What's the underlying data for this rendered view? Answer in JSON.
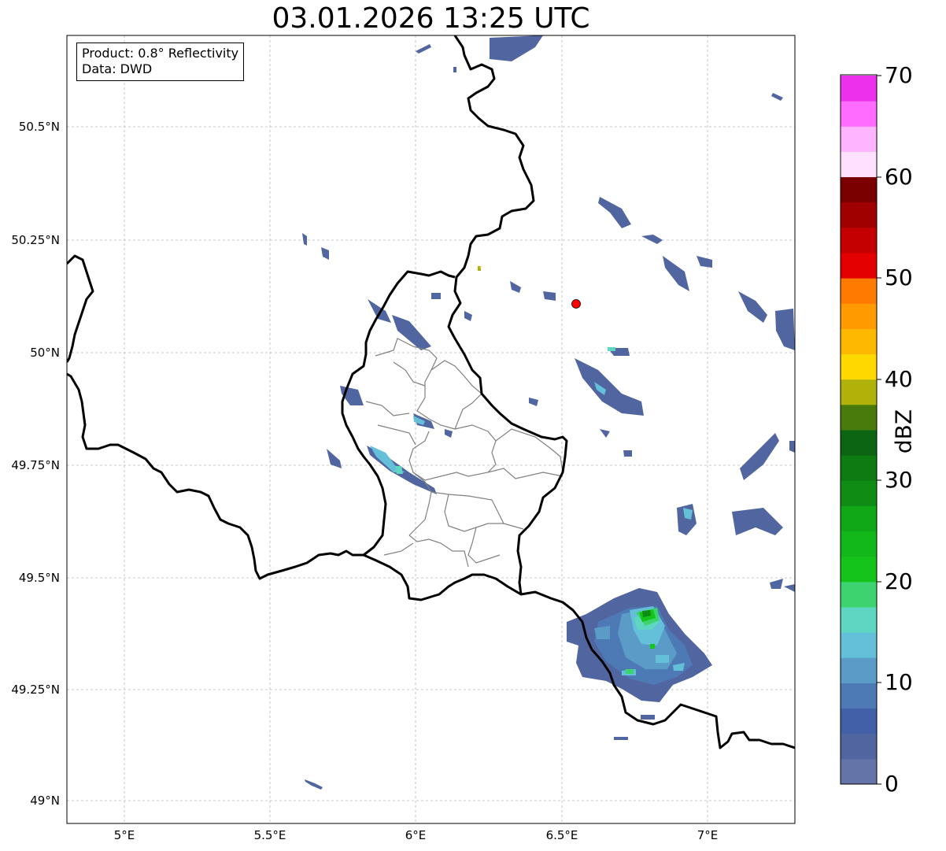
{
  "title": "03.01.2026 13:25 UTC",
  "info_box": {
    "product": "Product: 0.8° Reflectivity",
    "data": "Data: DWD"
  },
  "lat_labels": [
    "50.5°N",
    "50.25°N",
    "50°N",
    "49.75°N",
    "49.5°N",
    "49.25°N",
    "49°N"
  ],
  "lon_labels": [
    "5°E",
    "5.5°E",
    "6°E",
    "6.5°E",
    "7°E"
  ],
  "colorbar": {
    "unit": "dBZ",
    "tick_labels": [
      "70",
      "60",
      "50",
      "40",
      "30",
      "20",
      "10",
      "0"
    ],
    "colors": [
      "#6473a8",
      "#5166a0",
      "#4260a8",
      "#4d7ab5",
      "#5b9bc8",
      "#64bfd8",
      "#5ed6c2",
      "#3dd46f",
      "#14c41a",
      "#12b81a",
      "#10a816",
      "#0e8c14",
      "#0d7a12",
      "#0c6512",
      "#487a0c",
      "#b0b20a",
      "#ffd800",
      "#ffb800",
      "#ff9a00",
      "#ff7a00",
      "#e40000",
      "#c40000",
      "#a00000",
      "#7a0000",
      "#ffe0ff",
      "#ffb4ff",
      "#ff6cff",
      "#ec30ec"
    ]
  },
  "marker": {
    "color": "#ff0000"
  }
}
